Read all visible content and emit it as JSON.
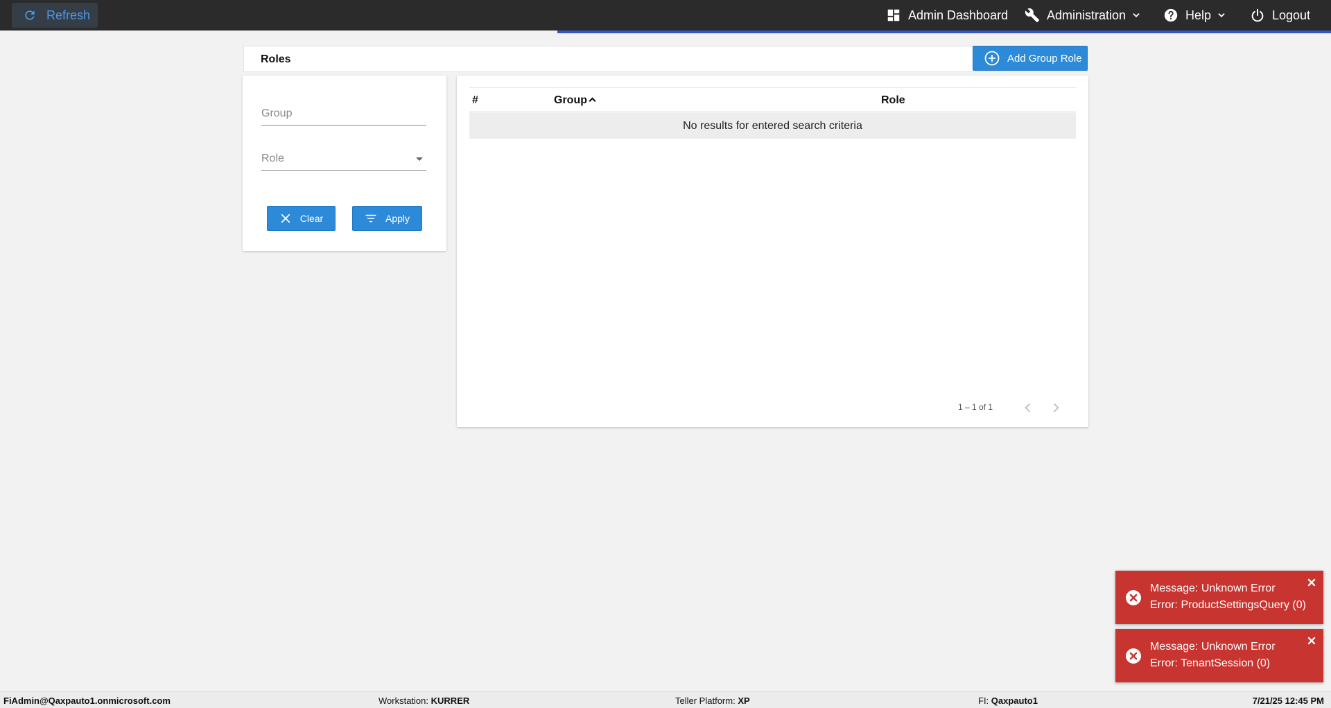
{
  "topbar": {
    "refresh_label": "Refresh",
    "nav": {
      "admin_dashboard": "Admin Dashboard",
      "administration": "Administration",
      "help": "Help",
      "logout": "Logout"
    }
  },
  "page": {
    "title": "Roles",
    "add_button_label": "Add Group Role"
  },
  "filters": {
    "group_placeholder": "Group",
    "role_placeholder": "Role",
    "clear_label": "Clear",
    "apply_label": "Apply"
  },
  "table": {
    "columns": [
      "#",
      "Group",
      "Role"
    ],
    "empty_message": "No results for entered search criteria",
    "pagination": "1 – 1 of 1"
  },
  "toasts": [
    {
      "line1": "Message: Unknown Error",
      "line2": "Error: ProductSettingsQuery (0)"
    },
    {
      "line1": "Message: Unknown Error",
      "line2": "Error: TenantSession (0)"
    }
  ],
  "statusbar": {
    "user": "FiAdmin@Qaxpauto1.onmicrosoft.com",
    "workstation_label": "Workstation:",
    "workstation_value": "KURRER",
    "platform_label": "Teller Platform:",
    "platform_value": "XP",
    "fi_label": "FI:",
    "fi_value": "Qaxpauto1",
    "datetime": "7/21/25 12:45 PM"
  },
  "colors": {
    "topbar_bg": "#2b2b2b",
    "accent_bar": "#3454c8",
    "primary_button": "#2d8ad8",
    "refresh_text": "#4a9be8",
    "error_toast": "#c8342f",
    "page_bg": "#f2f2f2"
  },
  "icons": {
    "refresh": "refresh-icon",
    "dashboard": "dashboard-icon",
    "administration": "wrench-icon",
    "help": "help-circle-icon",
    "logout": "power-icon",
    "add": "add-circle-icon",
    "clear": "close-icon",
    "apply": "filter-icon",
    "sort": "sort-ascending-icon",
    "prev": "chevron-left-icon",
    "next": "chevron-right-icon",
    "error": "error-circle-icon",
    "toast_close": "close-icon"
  }
}
